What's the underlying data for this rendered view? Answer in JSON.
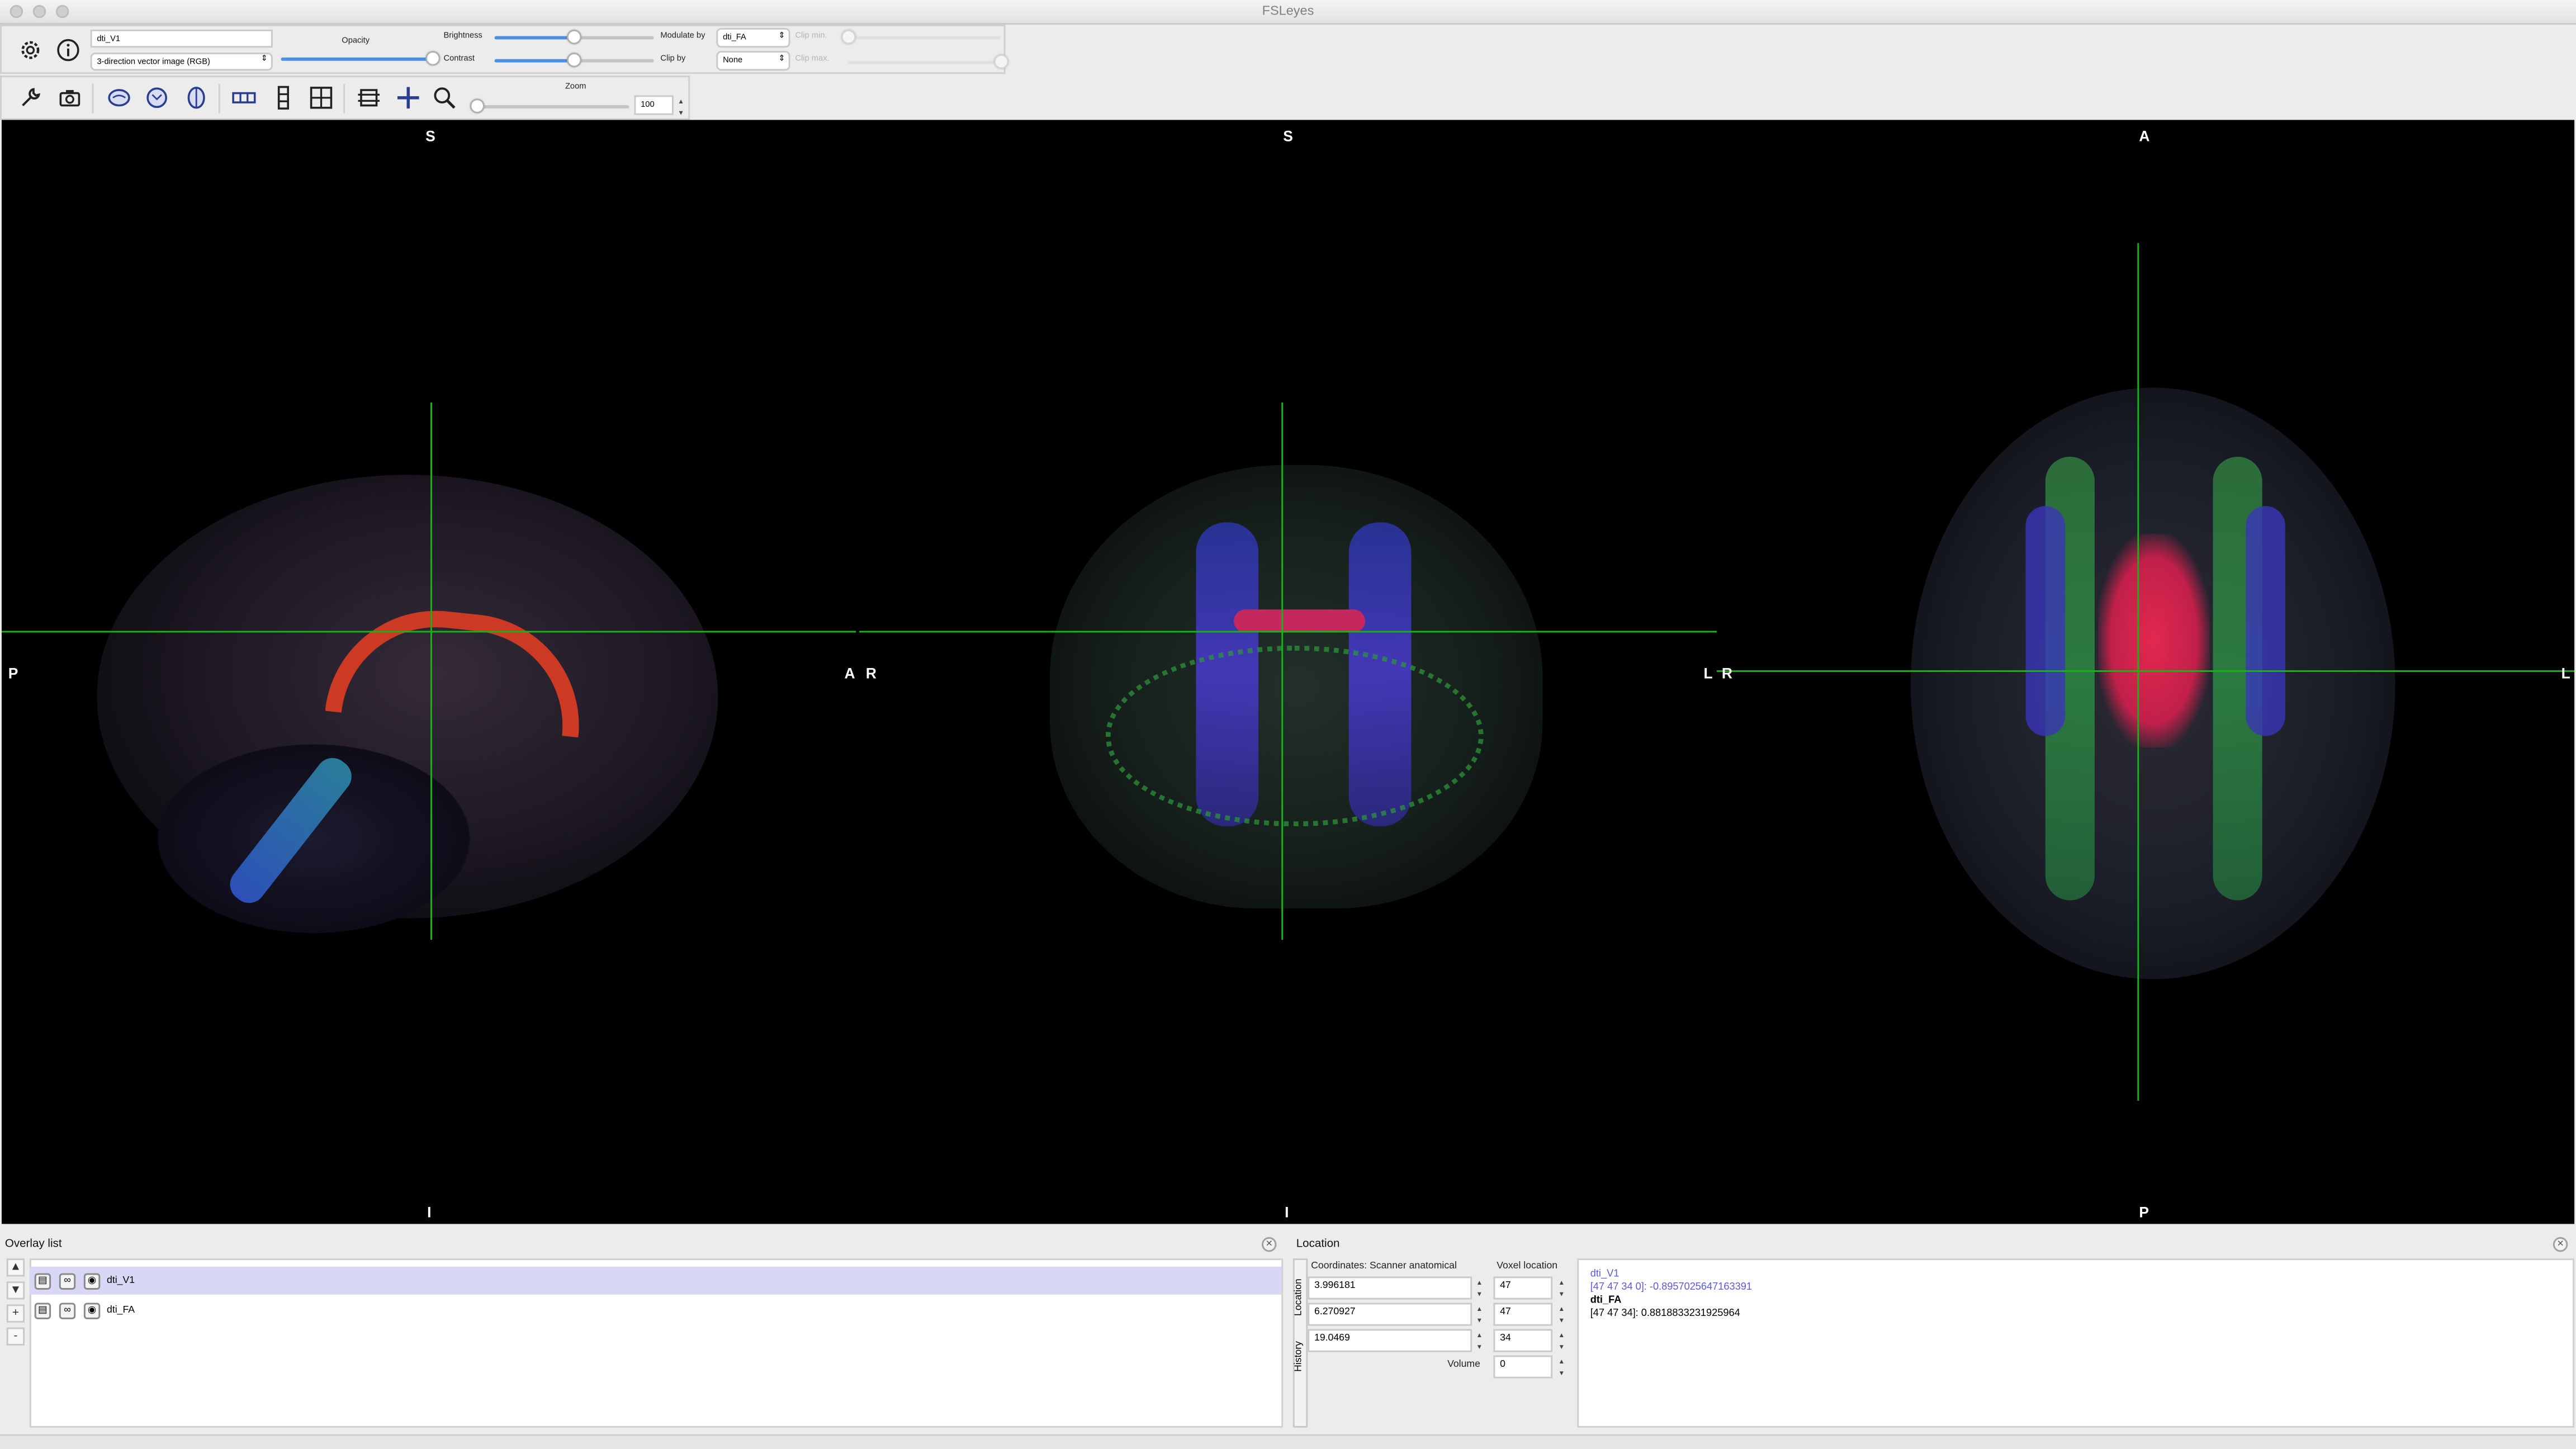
{
  "window": {
    "title": "FSLeyes"
  },
  "overlay_toolbar": {
    "overlay_name": "dti_V1",
    "overlay_type": "3-direction vector image (RGB)",
    "opacity_label": "Opacity",
    "opacity_level": 1.0,
    "brightness_label": "Brightness",
    "brightness_level": 0.5,
    "contrast_label": "Contrast",
    "contrast_level": 0.5,
    "modulate_by_label": "Modulate by",
    "modulate_by_value": "dti_FA",
    "clip_by_label": "Clip by",
    "clip_by_value": "None",
    "clip_min_label": "Clip min.",
    "clip_min_level": 0.0,
    "clip_max_label": "Clip max.",
    "clip_max_level": 1.0
  },
  "ortho_toolbar": {
    "zoom_label": "Zoom",
    "zoom_value": "100",
    "icons": [
      "wrench-icon",
      "camera-icon",
      "sagittal-icon",
      "coronal-icon",
      "axial-icon",
      "horizontal-layout-icon",
      "vertical-layout-icon",
      "grid-layout-icon",
      "reset-icon",
      "cursor-crosshair-icon",
      "zoom-icon"
    ]
  },
  "views": {
    "sagittal": {
      "top": "S",
      "bottom": "I",
      "left": "P",
      "right": "A"
    },
    "coronal": {
      "top": "S",
      "bottom": "I",
      "left": "R",
      "right": "L"
    },
    "axial": {
      "top": "A",
      "bottom": "P",
      "left": "R",
      "right": "L"
    },
    "cursor_color": "#19b319"
  },
  "overlay_list": {
    "title": "Overlay list",
    "items": [
      {
        "name": "dti_V1",
        "selected": true
      },
      {
        "name": "dti_FA",
        "selected": false
      }
    ],
    "buttons": [
      "▲",
      "▼",
      "+",
      "-"
    ]
  },
  "location": {
    "title": "Location",
    "side_tabs": [
      "Location",
      "History"
    ],
    "coords_header": "Coordinates: Scanner anatomical",
    "voxel_header": "Voxel location",
    "coords": [
      "3.996181",
      "6.270927",
      "19.0469"
    ],
    "voxels": [
      "47",
      "47",
      "34"
    ],
    "volume_label": "Volume",
    "volume_value": "0",
    "info": [
      {
        "name": "dti_V1",
        "value": "[47 47 34 0]: -0.8957025647163391",
        "color": "#5a5ae0"
      },
      {
        "name": "dti_FA",
        "value": "[47 47 34]: 0.8818833231925964",
        "color": "#000000"
      }
    ]
  }
}
